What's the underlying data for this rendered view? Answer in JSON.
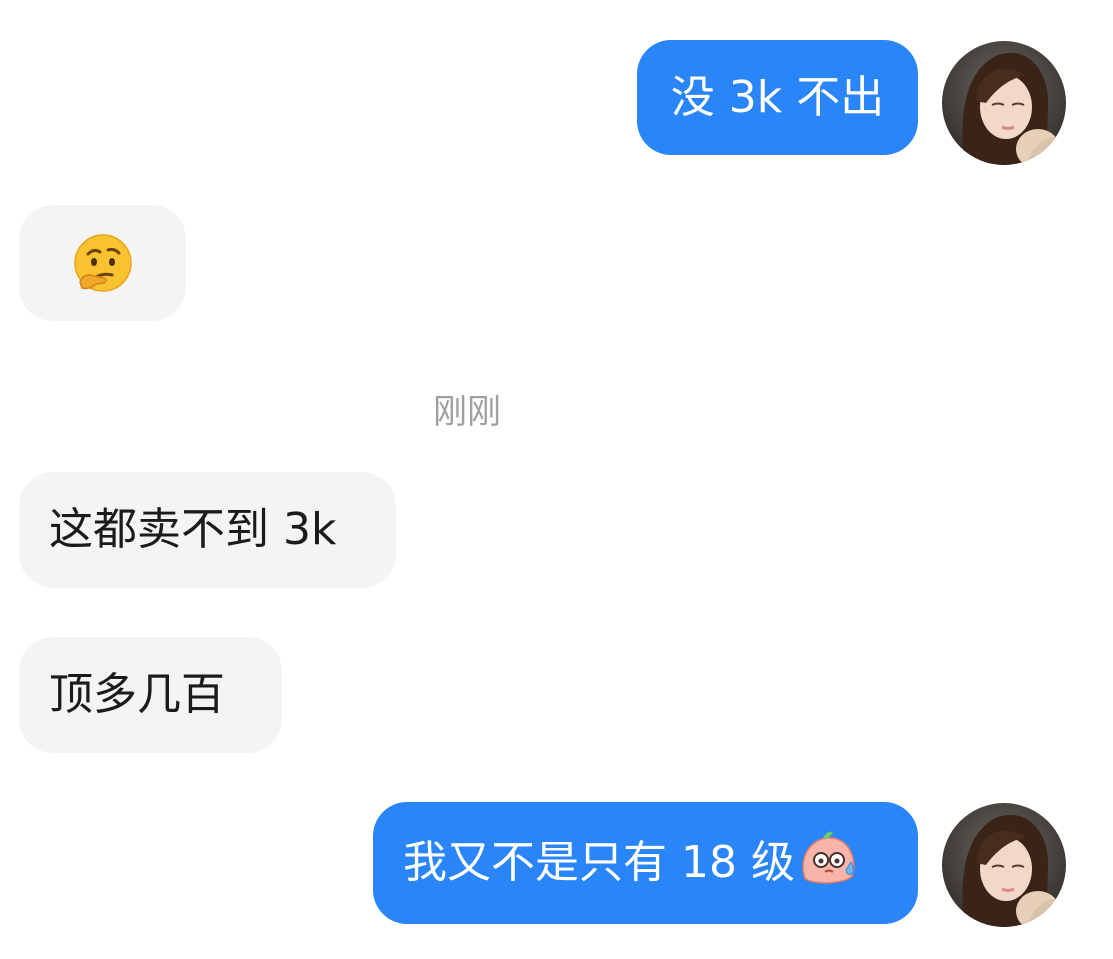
{
  "messages": [
    {
      "direction": "out",
      "text": "没 3k 不出"
    },
    {
      "direction": "in",
      "emoji": "thinking-face"
    },
    {
      "direction": "in",
      "text": "这都卖不到 3k"
    },
    {
      "direction": "in",
      "text": "顶多几百"
    },
    {
      "direction": "out",
      "text": "我又不是只有 18 级",
      "trailing_emoji": "sweating-blob-face"
    }
  ],
  "timestamp": "刚刚",
  "colors": {
    "outgoing_bubble": "#2a85f8",
    "incoming_bubble": "#f4f4f4",
    "timestamp_text": "#a0a0a0"
  }
}
